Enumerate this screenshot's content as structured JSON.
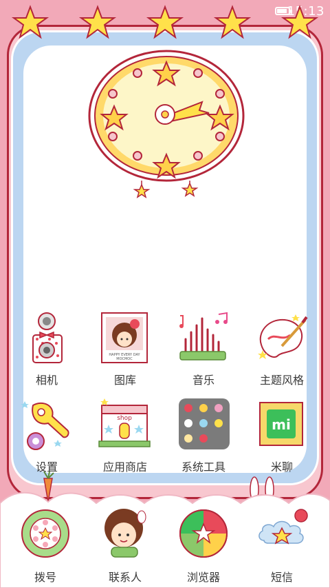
{
  "status_bar": {
    "time": "15:13",
    "battery_icon": "battery-icon"
  },
  "clock_widget": {
    "icon": "clock-icon"
  },
  "apps": [
    {
      "label": "相机",
      "icon": "camera-icon"
    },
    {
      "label": "图库",
      "icon": "gallery-icon",
      "photo_text_1": "HAPPY EVERY DAY",
      "photo_text_2": "MOCMOC"
    },
    {
      "label": "音乐",
      "icon": "music-icon"
    },
    {
      "label": "主题风格",
      "icon": "theme-icon"
    },
    {
      "label": "设置",
      "icon": "settings-icon"
    },
    {
      "label": "应用商店",
      "icon": "store-icon",
      "shop_text": "shop"
    },
    {
      "label": "系统工具",
      "icon": "system-tools-folder-icon"
    },
    {
      "label": "米聊",
      "icon": "miliao-icon",
      "mi_text": "mi"
    }
  ],
  "dock": [
    {
      "label": "拨号",
      "icon": "dialer-icon"
    },
    {
      "label": "联系人",
      "icon": "contacts-icon"
    },
    {
      "label": "浏览器",
      "icon": "browser-icon"
    },
    {
      "label": "短信",
      "icon": "messages-icon"
    }
  ],
  "colors": {
    "background": "#f2a9b8",
    "frame_border": "#b3263a",
    "inner_frame": "#bcd6f1",
    "star": "#ffe14a"
  }
}
